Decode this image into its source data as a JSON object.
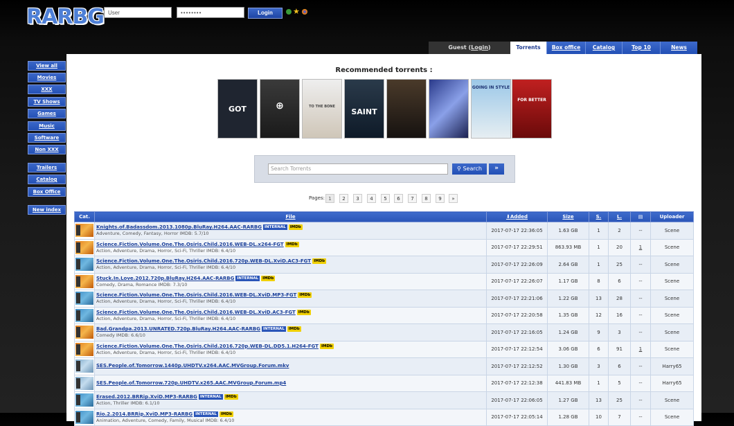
{
  "header": {
    "logo": "RARBG",
    "username_value": "User",
    "password_value": "••••••••",
    "login_label": "Login"
  },
  "nav": {
    "guest_prefix": "Guest (",
    "guest_login": "Login",
    "guest_suffix": ")",
    "tabs": [
      "Torrents",
      "Box office",
      "Catalog",
      "Top 10",
      "News"
    ],
    "active_tab": "Torrents"
  },
  "sidebar": {
    "items": [
      "View all",
      "Movies",
      "XXX",
      "TV Shows",
      "Games",
      "Music",
      "Software",
      "Non XXX"
    ],
    "items2": [
      "Trailers",
      "Catalog",
      "Box Office"
    ],
    "items3": [
      "New index"
    ]
  },
  "recommended": {
    "title": "Recommended torrents :",
    "posters": [
      {
        "label": "GOT",
        "color": "#1f2530"
      },
      {
        "label": "",
        "color": "#2a2a2a"
      },
      {
        "label": "TO THE BONE",
        "color": "#d8d2c8"
      },
      {
        "label": "SAINT",
        "color": "#1c2a3a"
      },
      {
        "label": "",
        "color": "#2b2620"
      },
      {
        "label": "",
        "color": "#3a4a7a"
      },
      {
        "label": "GOING IN STYLE",
        "color": "#7fb3d9"
      },
      {
        "label": "FOR BETTER",
        "color": "#b02020"
      }
    ]
  },
  "search": {
    "placeholder": "Search Torrents",
    "button": "Search",
    "advanced": "»"
  },
  "pager": {
    "label": "Pages:",
    "pages": [
      "1",
      "2",
      "3",
      "4",
      "5",
      "6",
      "7",
      "8",
      "9",
      "»"
    ],
    "current": "1"
  },
  "table": {
    "headers": [
      "Cat.",
      "File",
      "Added",
      "Size",
      "S.",
      "L.",
      "",
      "Uploader"
    ],
    "rows": [
      {
        "cat": "movie",
        "file": "Knights.of.Badassdom.2013.1080p.BluRay.H264.AAC-RARBG",
        "internal": true,
        "imdb": true,
        "genre": "Adventure, Comedy, Fantasy, Horror IMDB: 5.7/10",
        "added": "2017-07-17 22:36:05",
        "size": "1.63 GB",
        "s": "1",
        "l": "2",
        "c": "--",
        "uploader": "Scene"
      },
      {
        "cat": "movie",
        "file": "Science.Fiction.Volume.One.The.Osiris.Child.2016.WEB-DL.x264-FGT",
        "internal": false,
        "imdb": true,
        "genre": "Action, Adventure, Drama, Horror, Sci-Fi, Thriller IMDB: 6.4/10",
        "added": "2017-07-17 22:29:51",
        "size": "863.93 MB",
        "s": "1",
        "l": "20",
        "c": "1",
        "uploader": "Scene"
      },
      {
        "cat": "tv",
        "file": "Science.Fiction.Volume.One.The.Osiris.Child.2016.720p.WEB-DL.XviD.AC3-FGT",
        "internal": false,
        "imdb": true,
        "genre": "Action, Adventure, Drama, Horror, Sci-Fi, Thriller IMDB: 6.4/10",
        "added": "2017-07-17 22:26:09",
        "size": "2.64 GB",
        "s": "1",
        "l": "25",
        "c": "--",
        "uploader": "Scene"
      },
      {
        "cat": "movie",
        "file": "Stuck.In.Love.2012.720p.BluRay.H264.AAC-RARBG",
        "internal": true,
        "imdb": true,
        "genre": "Comedy, Drama, Romance IMDB: 7.3/10",
        "added": "2017-07-17 22:26:07",
        "size": "1.17 GB",
        "s": "8",
        "l": "6",
        "c": "--",
        "uploader": "Scene"
      },
      {
        "cat": "tv",
        "file": "Science.Fiction.Volume.One.The.Osiris.Child.2016.WEB-DL.XviD.MP3-FGT",
        "internal": false,
        "imdb": true,
        "genre": "Action, Adventure, Drama, Horror, Sci-Fi, Thriller IMDB: 6.4/10",
        "added": "2017-07-17 22:21:06",
        "size": "1.22 GB",
        "s": "13",
        "l": "28",
        "c": "--",
        "uploader": "Scene"
      },
      {
        "cat": "tv",
        "file": "Science.Fiction.Volume.One.The.Osiris.Child.2016.WEB-DL.XviD.AC3-FGT",
        "internal": false,
        "imdb": true,
        "genre": "Action, Adventure, Drama, Horror, Sci-Fi, Thriller IMDB: 6.4/10",
        "added": "2017-07-17 22:20:58",
        "size": "1.35 GB",
        "s": "12",
        "l": "16",
        "c": "--",
        "uploader": "Scene"
      },
      {
        "cat": "movie",
        "file": "Bad.Grandpa.2013.UNRATED.720p.BluRay.H264.AAC-RARBG",
        "internal": true,
        "imdb": true,
        "genre": "Comedy IMDB: 6.6/10",
        "added": "2017-07-17 22:16:05",
        "size": "1.24 GB",
        "s": "9",
        "l": "3",
        "c": "--",
        "uploader": "Scene"
      },
      {
        "cat": "movie",
        "file": "Science.Fiction.Volume.One.The.Osiris.Child.2016.720p.WEB-DL.DD5.1.H264-FGT",
        "internal": false,
        "imdb": true,
        "genre": "Action, Adventure, Drama, Horror, Sci-Fi, Thriller IMDB: 6.4/10",
        "added": "2017-07-17 22:12:54",
        "size": "3.06 GB",
        "s": "6",
        "l": "91",
        "c": "1",
        "uploader": "Scene"
      },
      {
        "cat": "tvhd",
        "file": "SES.People.of.Tomorrow.1440p.UHDTV.x264.AAC.MVGroup.Forum.mkv",
        "internal": false,
        "imdb": false,
        "genre": "",
        "added": "2017-07-17 22:12:52",
        "size": "1.30 GB",
        "s": "3",
        "l": "6",
        "c": "--",
        "uploader": "Harry65"
      },
      {
        "cat": "tvhd",
        "file": "SES.People.of.Tomorrow.720p.UHDTV.x265.AAC.MVGroup.Forum.mp4",
        "internal": false,
        "imdb": false,
        "genre": "",
        "added": "2017-07-17 22:12:38",
        "size": "441.83 MB",
        "s": "1",
        "l": "5",
        "c": "--",
        "uploader": "Harry65"
      },
      {
        "cat": "tv",
        "file": "Erased.2012.BRRip.XviD.MP3-RARBG",
        "internal": true,
        "imdb": true,
        "genre": "Action, Thriller IMDB: 6.1/10",
        "added": "2017-07-17 22:06:05",
        "size": "1.27 GB",
        "s": "13",
        "l": "25",
        "c": "--",
        "uploader": "Scene"
      },
      {
        "cat": "tv",
        "file": "Rio.2.2014.BRRip.XviD.MP3-RARBG",
        "internal": true,
        "imdb": true,
        "genre": "Animation, Adventure, Comedy, Family, Musical IMDB: 6.4/10",
        "added": "2017-07-17 22:05:14",
        "size": "1.28 GB",
        "s": "10",
        "l": "7",
        "c": "--",
        "uploader": "Scene"
      }
    ],
    "internal_label": "INTERNAL",
    "imdb_label": "IMDb"
  }
}
